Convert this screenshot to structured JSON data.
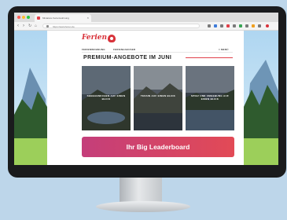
{
  "colors": {
    "background": "#bdd6ea",
    "brand": "#d8323a",
    "leaderboard_start": "#c43e7a",
    "leaderboard_end": "#e24a56"
  },
  "browser": {
    "tab_title": "Miniature Ferienwohnung",
    "url": "https://www.ferien.de",
    "window_controls": [
      "close",
      "minimize",
      "maximize"
    ]
  },
  "site": {
    "logo_text": "Ferien",
    "nav": [
      "FERIENWOHNUNG",
      "FERIENHAEUSER"
    ],
    "nav_right": "≡ MENÜ",
    "heading": "PREMIUM-ANGEBOTE IM JUNI",
    "cards": [
      {
        "label": "SEEBAENKCHEN AUF EINEN BLICK"
      },
      {
        "label": "TESSIN AUF EINEN BLICK"
      },
      {
        "label": "SPIEZ UND UMGEBUNG AUF EINEN BLICK"
      }
    ],
    "leaderboard": "Ihr Big Leaderboard"
  }
}
